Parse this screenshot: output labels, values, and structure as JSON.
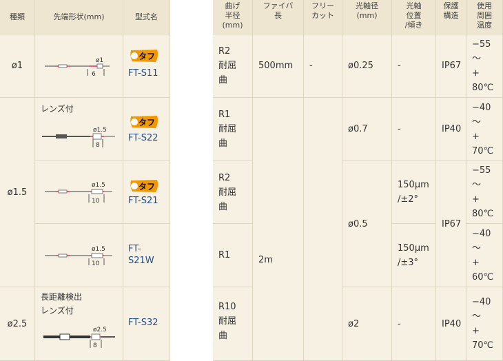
{
  "headers": {
    "type": "種類",
    "tip_shape": "先端形状(mm)",
    "model": "型式名",
    "bend_radius": "曲げ\n半径\n(mm)",
    "fiber_length": "ファイバ\n長",
    "free_cut": "フリー\nカット",
    "optical_axis_dia": "光軸径\n(mm)",
    "axis_position": "光軸\n位置\n/傾き",
    "protection": "保護\n構造",
    "temperature": "使用\n周囲\n温度"
  },
  "badge_text": "タフ",
  "rows": [
    {
      "type": "ø1",
      "model": "FT-S11",
      "tough": true,
      "note": "",
      "tip_dim": "ø1",
      "tip_len": "6",
      "bend": "R2\n耐屈\n曲",
      "length": "500mm",
      "free_cut": "-",
      "axis_dia": "ø0.25",
      "axis_pos": "-",
      "protection": "IP67",
      "temp": "−55\n〜\n+\n80℃"
    },
    {
      "type": "ø1.5",
      "model": "FT-S22",
      "tough": true,
      "note": "レンズ付",
      "tip_dim": "ø1.5",
      "tip_len": "8",
      "bend": "R1\n耐屈\n曲",
      "axis_dia": "ø0.7",
      "axis_pos": "-",
      "protection": "IP40",
      "temp": "−40\n〜\n+\n70℃"
    },
    {
      "model": "FT-S21",
      "tough": true,
      "note": "",
      "tip_dim": "ø1.5",
      "tip_len": "10",
      "bend": "R2\n耐屈\n曲",
      "axis_pos": "150μm\n/±2°",
      "temp": "−55\n〜\n+\n80℃"
    },
    {
      "model": "FT-\nS21W",
      "tough": false,
      "note": "",
      "tip_dim": "ø1.5",
      "tip_len": "10",
      "bend": "R1",
      "axis_pos": "150μm\n/±3°",
      "temp": "−40\n〜\n+\n60℃"
    },
    {
      "type": "ø2.5",
      "model": "FT-S32",
      "tough": false,
      "note": "長距離検出\nレンズ付",
      "tip_dim": "ø2.5",
      "tip_len": "8",
      "bend": "R10\n耐屈\n曲",
      "axis_dia": "ø2",
      "axis_pos": "-",
      "protection": "IP40",
      "temp": "−40\n〜\n+\n70℃"
    }
  ],
  "merged": {
    "length_2m": "2m",
    "free_cut_rows_2_5": "",
    "axis_dia_rows_3_4": "ø0.5",
    "protection_rows_3_4": "IP67",
    "type_rows_2_4": "ø1.5"
  },
  "colors": {
    "bg": "#f7f1e4",
    "header": "#efe6d2",
    "model_link": "#1f4f8f",
    "badge": "#f39800",
    "fiber": "#e85a7a"
  }
}
